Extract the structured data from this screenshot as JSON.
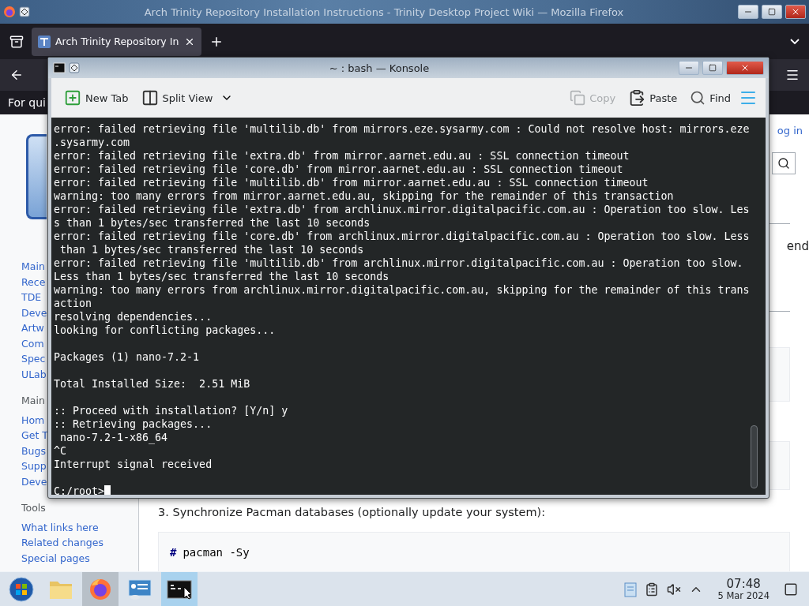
{
  "firefox": {
    "title": "Arch Trinity Repository Installation Instructions - Trinity Desktop Project Wiki — Mozilla Firefox",
    "tabs": [
      {
        "label": "Arch Trinity Repository In",
        "selected": true
      }
    ],
    "notice": "For qui",
    "login": "og in",
    "sidebar": {
      "nav": [
        "Main",
        "Rece",
        "TDE",
        "Deve",
        "Artw",
        "Com",
        "Spec",
        "ULab"
      ],
      "heading": "Main",
      "nav2": [
        "Hom",
        "Get T",
        "Bugs",
        "Supp",
        "Deve"
      ],
      "tools_heading": "Tools",
      "tools": [
        "What links here",
        "Related changes",
        "Special pages"
      ]
    },
    "content": {
      "fragment": "end",
      "step": "3. Synchronize Pacman databases (optionally update your system):",
      "code_prompt": "#",
      "code": "pacman -Sy"
    }
  },
  "konsole": {
    "title": "~ : bash — Konsole",
    "toolbar": [
      {
        "kind": "new-tab",
        "label": "New Tab",
        "disabled": false
      },
      {
        "kind": "split",
        "label": "Split View",
        "disabled": false
      },
      {
        "kind": "copy",
        "label": "Copy",
        "disabled": true
      },
      {
        "kind": "paste",
        "label": "Paste",
        "disabled": false
      },
      {
        "kind": "find",
        "label": "Find",
        "disabled": false
      }
    ],
    "blocks": [
      [
        "error: failed retrieving file 'multilib.db' from mirrors.eze.sysarmy.com : Could not resolve host: mirrors.eze",
        ".sysarmy.com",
        "error: failed retrieving file 'extra.db' from mirror.aarnet.edu.au : SSL connection timeout",
        "error: failed retrieving file 'core.db' from mirror.aarnet.edu.au : SSL connection timeout",
        "error: failed retrieving file 'multilib.db' from mirror.aarnet.edu.au : SSL connection timeout",
        "warning: too many errors from mirror.aarnet.edu.au, skipping for the remainder of this transaction",
        "error: failed retrieving file 'extra.db' from archlinux.mirror.digitalpacific.com.au : Operation too slow. Les",
        "s than 1 bytes/sec transferred the last 10 seconds",
        "error: failed retrieving file 'core.db' from archlinux.mirror.digitalpacific.com.au : Operation too slow. Less",
        " than 1 bytes/sec transferred the last 10 seconds",
        "error: failed retrieving file 'multilib.db' from archlinux.mirror.digitalpacific.com.au : Operation too slow.",
        "Less than 1 bytes/sec transferred the last 10 seconds",
        "warning: too many errors from archlinux.mirror.digitalpacific.com.au, skipping for the remainder of this trans",
        "action",
        "resolving dependencies...",
        "looking for conflicting packages..."
      ],
      [
        "Packages (1) nano-7.2-1"
      ],
      [
        "Total Installed Size:  2.51 MiB"
      ],
      [
        ":: Proceed with installation? [Y/n] y",
        ":: Retrieving packages...",
        " nano-7.2-1-x86_64",
        "^C",
        "Interrupt signal received"
      ]
    ],
    "prompt": "C:/root>"
  },
  "taskbar": {
    "apps": [
      {
        "kind": "start",
        "selected": false,
        "running": false
      },
      {
        "kind": "files",
        "selected": false,
        "running": false
      },
      {
        "kind": "firefox",
        "selected": false,
        "running": true
      },
      {
        "kind": "settings",
        "selected": false,
        "running": false
      },
      {
        "kind": "terminal",
        "selected": true,
        "running": true
      }
    ],
    "clock": {
      "time": "07:48",
      "date": "5 Mar 2024"
    }
  }
}
